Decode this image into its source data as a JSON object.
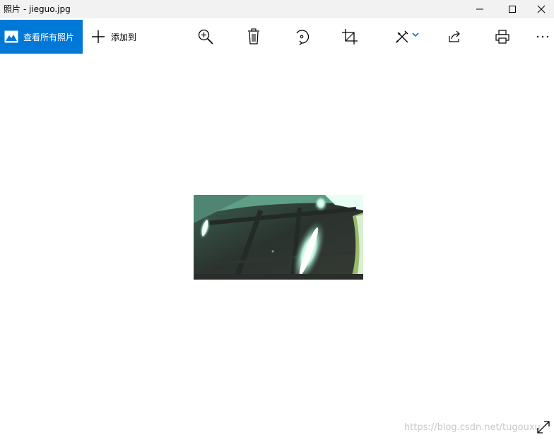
{
  "window": {
    "title": "照片 - jieguo.jpg"
  },
  "toolbar": {
    "view_all_label": "查看所有照片",
    "add_to_label": "添加到",
    "tools": [
      {
        "icon": "zoom-in-icon"
      },
      {
        "icon": "trash-icon"
      },
      {
        "icon": "rotate-icon"
      },
      {
        "icon": "crop-icon"
      },
      {
        "icon": "edit-icon"
      },
      {
        "icon": "share-icon"
      },
      {
        "icon": "print-icon"
      },
      {
        "icon": "more-icon"
      }
    ]
  },
  "watermark": "https://blog.csdn.net/tugouxu",
  "colors": {
    "accent": "#0078d7",
    "titlebar": "#f2f2f2"
  }
}
